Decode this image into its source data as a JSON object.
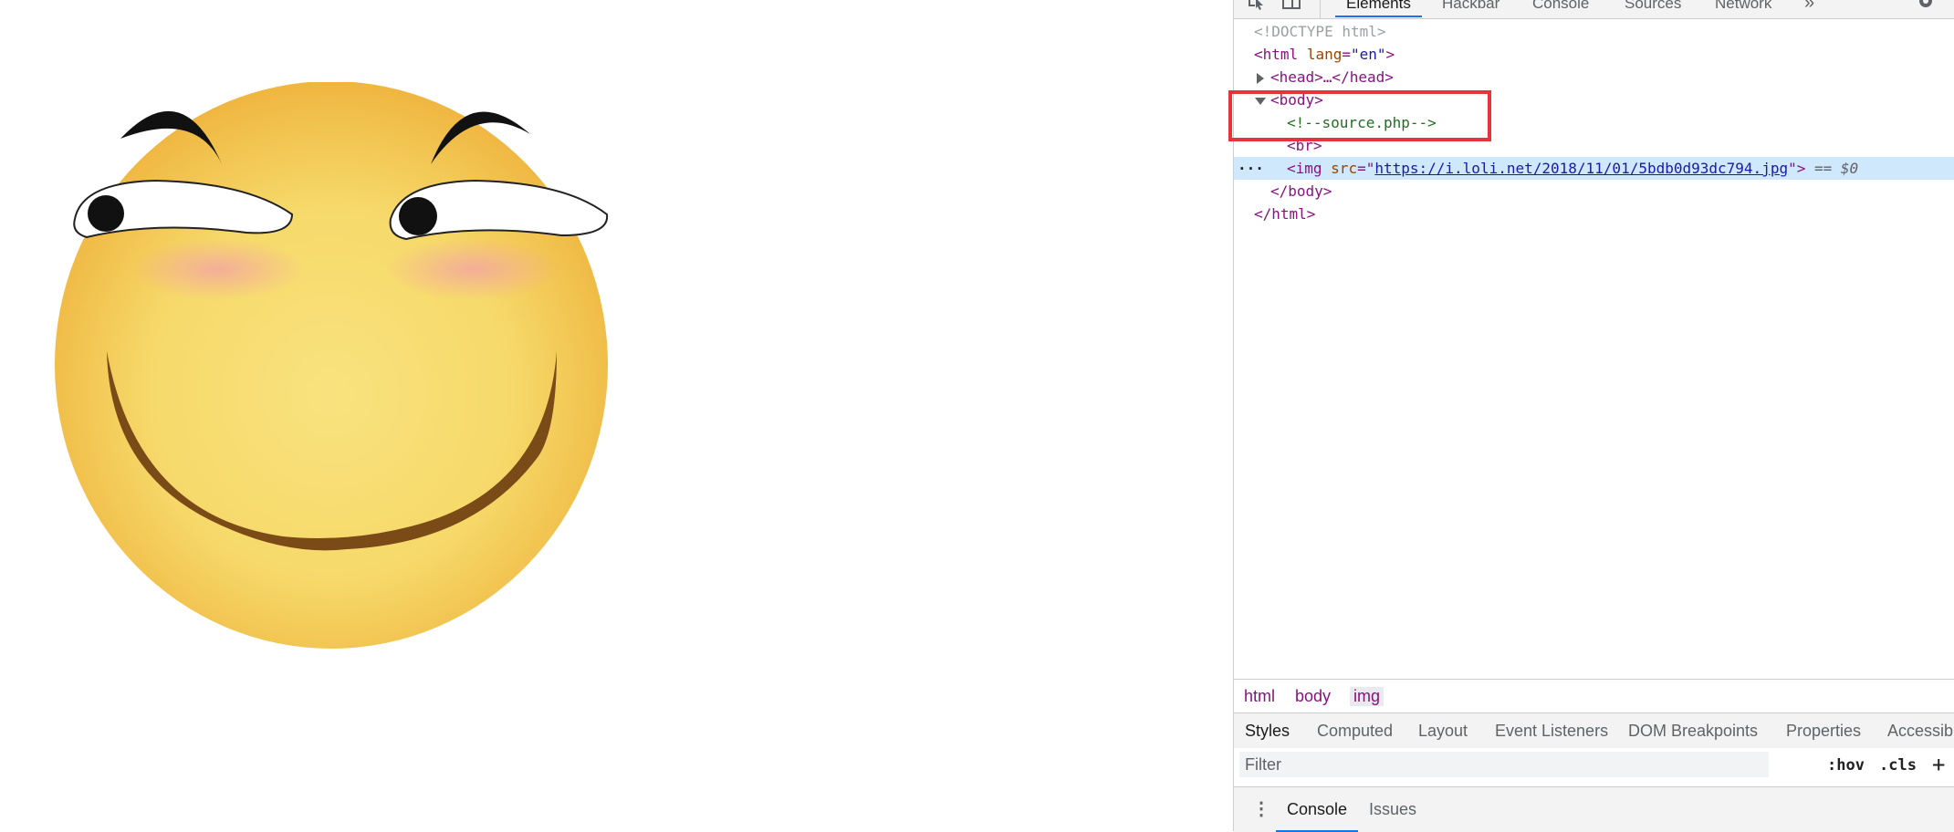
{
  "page": {
    "image_alt": "smiling emoji face with raised eyebrows"
  },
  "devtools": {
    "tabs": [
      {
        "label": "Elements",
        "active": true
      },
      {
        "label": "Hackbar",
        "active": false
      },
      {
        "label": "Console",
        "active": false
      },
      {
        "label": "Sources",
        "active": false
      },
      {
        "label": "Network",
        "active": false
      }
    ],
    "more_tabs": "»",
    "dom": {
      "doctype": "<!DOCTYPE html>",
      "html_open": "<html",
      "html_lang_attr": "lang",
      "html_lang_val": "\"en\"",
      "head_collapsed": "<head>…</head>",
      "body_open": "<body>",
      "comment": "<!--source.php-->",
      "br": "<br>",
      "img_open": "<img",
      "img_src_attr": "src",
      "img_src_val": "https://i.loli.net/2018/11/01/5bdb0d93dc794.jpg",
      "img_close": ">",
      "selected_marker": "== $0",
      "ellipsis": "···",
      "body_close": "</body>",
      "html_close": "</html>"
    },
    "breadcrumbs": [
      "html",
      "body",
      "img"
    ],
    "styles_tabs": [
      {
        "label": "Styles",
        "active": true
      },
      {
        "label": "Computed",
        "active": false
      },
      {
        "label": "Layout",
        "active": false
      },
      {
        "label": "Event Listeners",
        "active": false
      },
      {
        "label": "DOM Breakpoints",
        "active": false
      },
      {
        "label": "Properties",
        "active": false
      },
      {
        "label": "Accessibility",
        "active": false
      }
    ],
    "filter": {
      "placeholder": "Filter",
      "hov": ":hov",
      "cls": ".cls",
      "add": "+"
    },
    "drawer": {
      "menu": "⋮",
      "tabs": [
        {
          "label": "Console",
          "active": true
        },
        {
          "label": "Issues",
          "active": false
        }
      ]
    }
  },
  "colors": {
    "highlight": "#e8333d",
    "selection": "#cfe8fc",
    "tag": "#881280",
    "attr_name": "#994500",
    "attr_value": "#1a1aa6",
    "comment": "#236e25"
  }
}
